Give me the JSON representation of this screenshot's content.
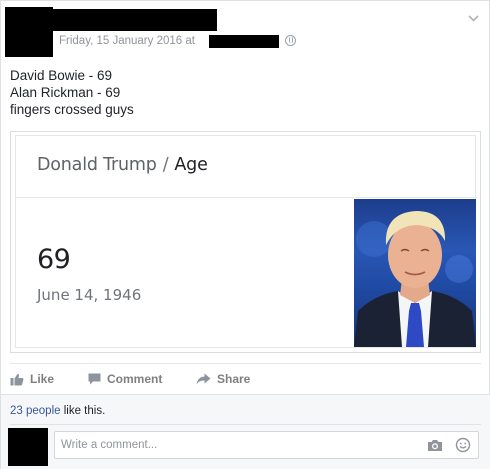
{
  "post": {
    "meta_text": "Friday, 15 January 2016 at",
    "lines": [
      "David Bowie - 69",
      "Alan Rickman - 69",
      "fingers crossed guys"
    ]
  },
  "card": {
    "entity": "Donald Trump",
    "separator": "/",
    "attribute": "Age",
    "value": "69",
    "date": "June 14, 1946"
  },
  "actions": {
    "like": "Like",
    "comment": "Comment",
    "share": "Share"
  },
  "likes": {
    "count_text": "23 people",
    "suffix": " like this."
  },
  "comment_box": {
    "placeholder": "Write a comment..."
  },
  "colors": {
    "link": "#365899",
    "muted": "#90949c",
    "action": "#7f7f7f"
  }
}
